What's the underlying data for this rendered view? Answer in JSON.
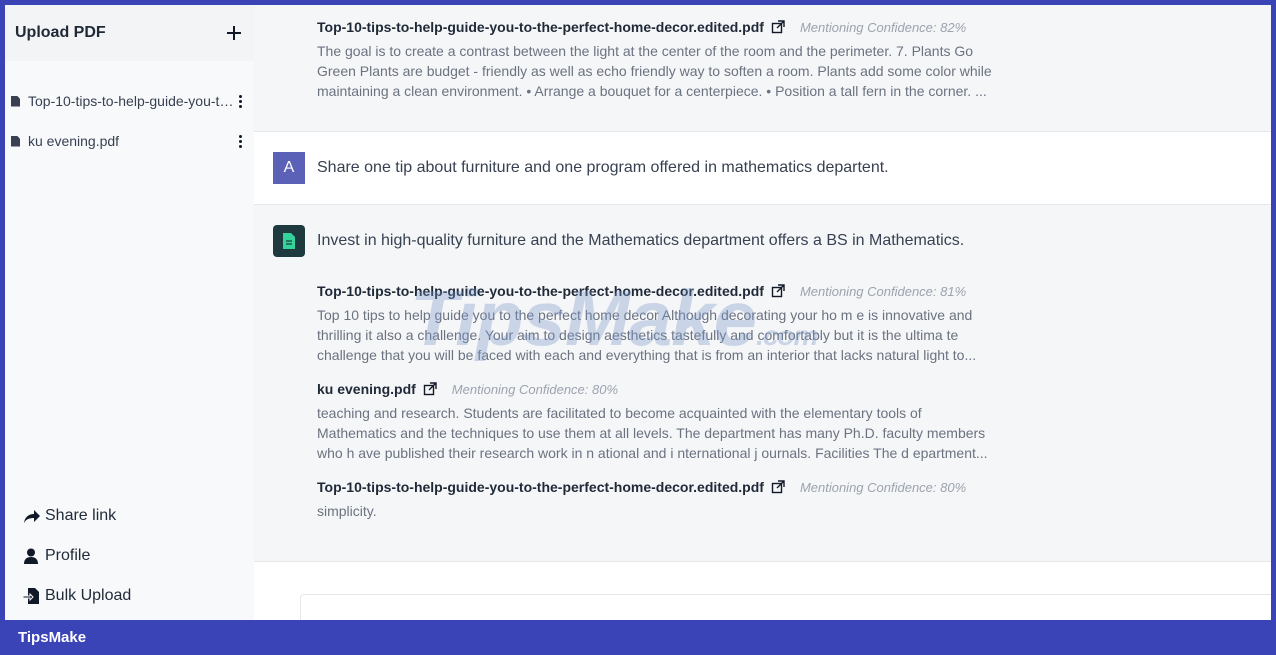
{
  "sidebar": {
    "title": "Upload PDF",
    "files": [
      {
        "name": "Top-10-tips-to-help-guide-you-to-the-perfect-home-decor.edited.pdf"
      },
      {
        "name": "ku evening.pdf"
      }
    ],
    "footer": [
      {
        "label": "Share link",
        "icon": "share-icon"
      },
      {
        "label": "Profile",
        "icon": "user-icon"
      },
      {
        "label": "Bulk Upload",
        "icon": "file-upload-icon"
      }
    ]
  },
  "chat": {
    "top_source": {
      "title": "Top-10-tips-to-help-guide-you-to-the-perfect-home-decor.edited.pdf",
      "confidence": "Mentioning Confidence: 82%",
      "text": "The goal is to create a contrast between the light at the center of the room and the perimeter. 7. Plants Go Green Plants are budget - friendly as well as echo friendly way to soften a room. Plants add some color while maintaining a clean environment. • Arrange a bouquet for a centerpiece. • Position a tall fern in the corner. ..."
    },
    "user_message": {
      "avatar_letter": "A",
      "text": "Share one tip about furniture and one program offered in mathematics departent."
    },
    "bot_message": {
      "text": "Invest in high-quality furniture and the Mathematics department offers a BS in Mathematics.",
      "sources": [
        {
          "title": "Top-10-tips-to-help-guide-you-to-the-perfect-home-decor.edited.pdf",
          "confidence": "Mentioning Confidence: 81%",
          "text": "Top 10 tips to help guide you to the perfect home decor Although decorating your ho m e is innovative and thrilling it also a challenge. Your aim to design aesthetics tastefully and comfortably but it is the ultima te challenge that you will be faced with each and everything that is from an interior that lacks natural light to..."
        },
        {
          "title": "ku evening.pdf",
          "confidence": "Mentioning Confidence: 80%",
          "text": "teaching and research. Students are facilitated to become acquainted with the elementary tools of Mathematics and the techniques to use them at all levels. The department has many Ph.D. faculty members who h ave published their research work in n ational and i nternational j ournals. Facilities The d epartment..."
        },
        {
          "title": "Top-10-tips-to-help-guide-you-to-the-perfect-home-decor.edited.pdf",
          "confidence": "Mentioning Confidence: 80%",
          "text": "simplicity."
        }
      ]
    }
  },
  "watermark": {
    "brand": "TipsMake",
    "suffix": ".com"
  },
  "brand_bar": {
    "label": "TipsMake"
  },
  "colors": {
    "accent": "#3a44b7",
    "avatar": "#5b61b6"
  }
}
